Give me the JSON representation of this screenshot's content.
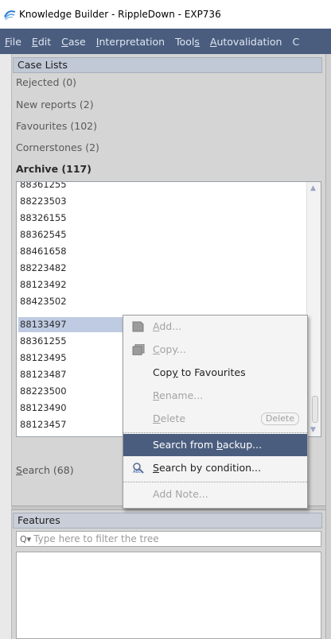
{
  "window": {
    "title": "Knowledge Builder - RippleDown - EXP736",
    "icon": "rippledown-app-icon"
  },
  "menubar": {
    "items": [
      {
        "label": "File",
        "mnemonic_index": 0
      },
      {
        "label": "Edit",
        "mnemonic_index": 0
      },
      {
        "label": "Case",
        "mnemonic_index": 0
      },
      {
        "label": "Interpretation",
        "mnemonic_index": 0
      },
      {
        "label": "Tools",
        "mnemonic_index": 4
      },
      {
        "label": "Autovalidation",
        "mnemonic_index": 0
      },
      {
        "label": "C",
        "mnemonic_index": -1
      }
    ]
  },
  "case_lists": {
    "header": "Case Lists",
    "items": [
      {
        "label": "Rejected (0)",
        "active": false
      },
      {
        "label": "New reports (2)",
        "active": false
      },
      {
        "label": "Favourites (102)",
        "active": false
      },
      {
        "label": "Cornerstones (2)",
        "active": false
      },
      {
        "label": "Archive (117)",
        "active": true
      }
    ],
    "archive_cases": [
      "88361255",
      "88223503",
      "88326155",
      "88362545",
      "88461658",
      "88223482",
      "88123492",
      "88423502",
      "88133497",
      "88361255",
      "88123495",
      "88123487",
      "88223500",
      "88123490",
      "88123457"
    ],
    "selected_case": "88133497",
    "search_item": "Search (68)"
  },
  "context_menu": {
    "items": [
      {
        "label": "Add...",
        "enabled": false,
        "icon": "add-icon"
      },
      {
        "label": "Copy...",
        "enabled": false,
        "icon": "copy-icon"
      },
      {
        "label": "Copy to Favourites",
        "enabled": true
      },
      {
        "label": "Rename...",
        "enabled": false
      },
      {
        "label": "Delete",
        "enabled": false,
        "shortcut": "Delete"
      },
      {
        "label": "Search from backup...",
        "enabled": true,
        "highlighted": true
      },
      {
        "label": "Search by condition...",
        "enabled": true,
        "icon": "search-condition-icon"
      },
      {
        "label": "Add Note...",
        "enabled": false
      }
    ]
  },
  "features": {
    "header": "Features",
    "filter_placeholder": "Type here to filter the tree",
    "filter_value": ""
  },
  "colors": {
    "menubar": "#4a5d7e",
    "highlight": "#4a5d7e",
    "selection": "#bfcbe2",
    "header": "#c1c8d6"
  }
}
